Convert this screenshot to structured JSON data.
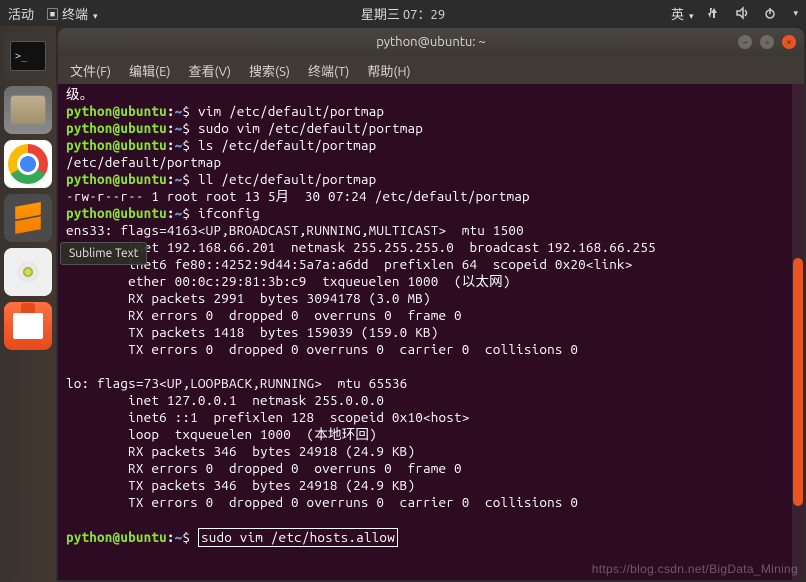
{
  "topbar": {
    "activities": "活动",
    "app_indicator": "终端",
    "datetime": "星期三 07：29",
    "ime": "英"
  },
  "launcher": {
    "tooltip": "Sublime Text"
  },
  "window": {
    "title": "python@ubuntu: ~"
  },
  "menubar": {
    "file": "文件(F)",
    "edit": "编辑(E)",
    "view": "查看(V)",
    "search": "搜索(S)",
    "terminal": "终端(T)",
    "help": "帮助(H)"
  },
  "prompt": {
    "user": "python@ubuntu",
    "sep": ":",
    "path": "~",
    "dollar": "$"
  },
  "lines": {
    "l0": "级。",
    "c1": " vim /etc/default/portmap",
    "c2": " sudo vim /etc/default/portmap",
    "c3": " ls /etc/default/portmap",
    "o3": "/etc/default/portmap",
    "c4": " ll /etc/default/portmap",
    "o4": "-rw-r--r-- 1 root root 13 5月  30 07:24 /etc/default/portmap",
    "c5": " ifconfig",
    "if1": "ens33: flags=4163<UP,BROADCAST,RUNNING,MULTICAST>  mtu 1500",
    "if2": "        inet 192.168.66.201  netmask 255.255.255.0  broadcast 192.168.66.255",
    "if3": "        inet6 fe80::4252:9d44:5a7a:a6dd  prefixlen 64  scopeid 0x20<link>",
    "if4": "        ether 00:0c:29:81:3b:c9  txqueuelen 1000  (以太网)",
    "if5": "        RX packets 2991  bytes 3094178 (3.0 MB)",
    "if6": "        RX errors 0  dropped 0  overruns 0  frame 0",
    "if7": "        TX packets 1418  bytes 159039 (159.0 KB)",
    "if8": "        TX errors 0  dropped 0 overruns 0  carrier 0  collisions 0",
    "lo1": "lo: flags=73<UP,LOOPBACK,RUNNING>  mtu 65536",
    "lo2": "        inet 127.0.0.1  netmask 255.0.0.0",
    "lo3": "        inet6 ::1  prefixlen 128  scopeid 0x10<host>",
    "lo4": "        loop  txqueuelen 1000  (本地环回)",
    "lo5": "        RX packets 346  bytes 24918 (24.9 KB)",
    "lo6": "        RX errors 0  dropped 0  overruns 0  frame 0",
    "lo7": "        TX packets 346  bytes 24918 (24.9 KB)",
    "lo8": "        TX errors 0  dropped 0 overruns 0  carrier 0  collisions 0",
    "c6_pre": " ",
    "c6_box": "sudo vim /etc/hosts.allow"
  },
  "watermark": "https://blog.csdn.net/BigData_Mining"
}
